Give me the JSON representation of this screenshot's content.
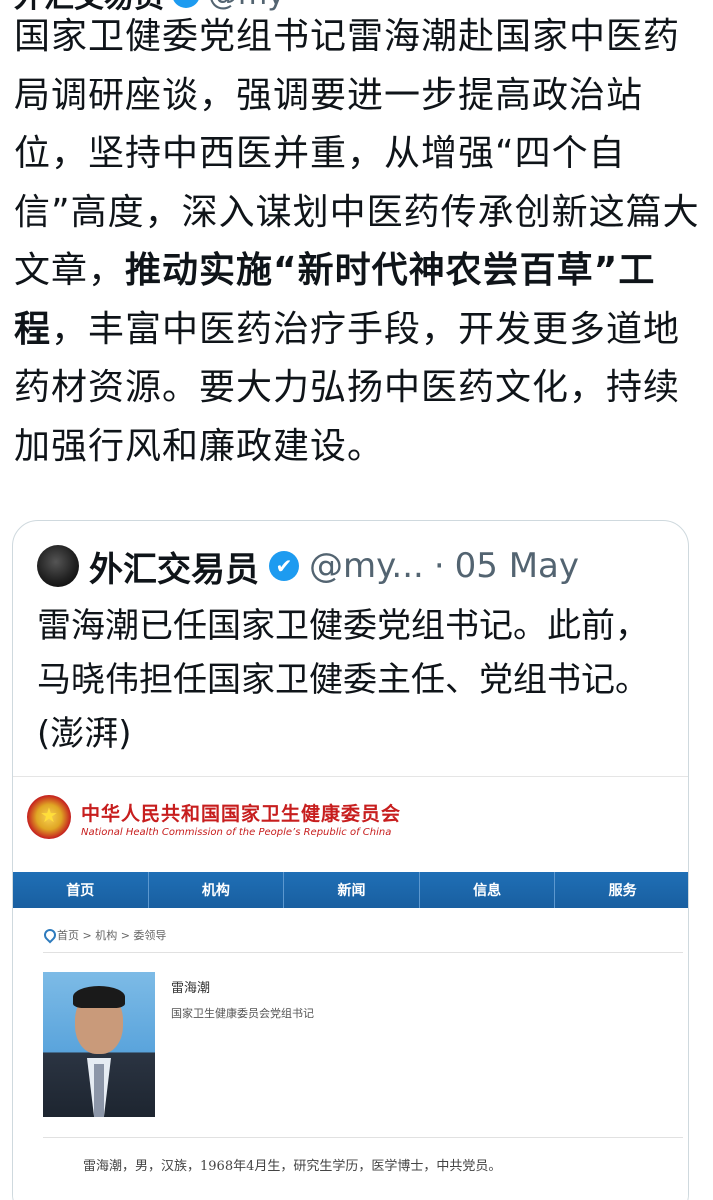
{
  "tweet": {
    "author_name": "外汇交易员",
    "author_handle": "@my",
    "text_pre": "国家卫健委党组书记雷海潮赴国家中医药局调研座谈，强调要进一步提高政治站位，坚持中西医并重，从增强“四个自信”高度，深入谋划中医药传承创新这篇大文章，",
    "text_bold": "推动实施“新时代神农尝百草”工程",
    "text_post": "，丰富中医药治疗手段，开发更多道地药材资源。要大力弘扬中医药文化，持续加强行风和廉政建设。"
  },
  "quote": {
    "author_name": "外汇交易员",
    "verified_icon": "✔",
    "handle": "@my...",
    "separator": "·",
    "date": "05 May",
    "text": "雷海潮已任国家卫健委党组书记。此前，马晓伟担任国家卫健委主任、党组书记。(澎湃)"
  },
  "site": {
    "title": "中华人民共和国国家卫生健康委员会",
    "subtitle": "National Health Commission of the People’s Republic of China",
    "nav": [
      "首页",
      "机构",
      "新闻",
      "信息",
      "服务"
    ],
    "breadcrumb": "首页 > 机构 > 委领导",
    "person_name": "雷海潮",
    "person_title": "国家卫生健康委员会党组书记",
    "bio": "雷海潮，男，汉族，1968年4月生，研究生学历，医学博士，中共党员。"
  },
  "colors": {
    "verified_blue": "#1d9bf0",
    "nav_blue": "#1f6fb6",
    "site_red": "#c71e1e"
  }
}
